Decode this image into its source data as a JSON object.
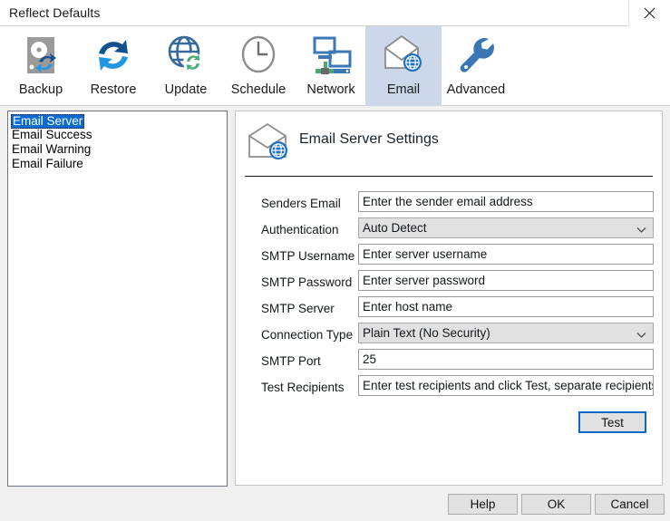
{
  "window": {
    "title": "Reflect Defaults",
    "close_icon": "close-icon"
  },
  "toolbar": {
    "tabs": [
      {
        "label": "Backup",
        "icon": "hard-disk-backup-icon",
        "selected": false
      },
      {
        "label": "Restore",
        "icon": "restore-arrows-icon",
        "selected": false
      },
      {
        "label": "Update",
        "icon": "globe-refresh-icon",
        "selected": false
      },
      {
        "label": "Schedule",
        "icon": "clock-icon",
        "selected": false
      },
      {
        "label": "Network",
        "icon": "network-computers-icon",
        "selected": false
      },
      {
        "label": "Email",
        "icon": "envelope-globe-icon",
        "selected": true
      },
      {
        "label": "Advanced",
        "icon": "wrench-icon",
        "selected": false
      }
    ],
    "selected_tab": "Email",
    "highlight_color": "#ccd8ea"
  },
  "sidebar": {
    "items": [
      {
        "label": "Email Server",
        "selected": true
      },
      {
        "label": "Email Success",
        "selected": false
      },
      {
        "label": "Email Warning",
        "selected": false
      },
      {
        "label": "Email Failure",
        "selected": false
      }
    ],
    "selection_color": "#0a6cd1"
  },
  "panel": {
    "title": "Email Server Settings",
    "icon": "envelope-globe-icon"
  },
  "form": {
    "rows": [
      {
        "label": "Senders Email",
        "type": "text",
        "value": "Enter the sender email address",
        "name": "senders-email"
      },
      {
        "label": "Authentication",
        "type": "select",
        "value": "Auto Detect",
        "name": "authentication"
      },
      {
        "label": "SMTP Username",
        "type": "text",
        "value": "Enter server username",
        "name": "smtp-username"
      },
      {
        "label": "SMTP Password",
        "type": "text",
        "value": "Enter server password",
        "name": "smtp-password"
      },
      {
        "label": "SMTP Server",
        "type": "text",
        "value": "Enter host name",
        "name": "smtp-server"
      },
      {
        "label": "Connection Type",
        "type": "select",
        "value": "Plain Text (No Security)",
        "name": "connection-type"
      },
      {
        "label": "SMTP Port",
        "type": "text",
        "value": "25",
        "name": "smtp-port"
      },
      {
        "label": "Test Recipients",
        "type": "text",
        "value": "Enter test recipients and click Test, separate recipients with ;",
        "name": "test-recipients"
      }
    ],
    "test_button": {
      "label": "Test",
      "focus_color": "#0a68c8"
    }
  },
  "footer": {
    "help_label": "Help",
    "ok_label": "OK",
    "cancel_label": "Cancel"
  }
}
